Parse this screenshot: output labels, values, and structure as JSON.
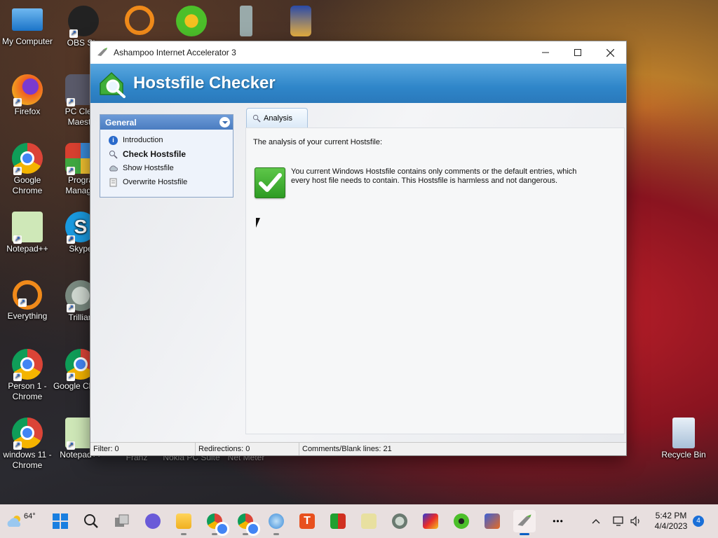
{
  "desktop": {
    "icons": [
      {
        "label": "My Computer"
      },
      {
        "label": "OBS Stu"
      },
      {
        "label": "Firefox"
      },
      {
        "label": "PC Clea Maestr"
      },
      {
        "label": "Google Chrome"
      },
      {
        "label": "Progra Manage"
      },
      {
        "label": "Notepad++"
      },
      {
        "label": "Skype"
      },
      {
        "label": "Everything"
      },
      {
        "label": "Trillian"
      },
      {
        "label": "Person 1 - Chrome"
      },
      {
        "label": "Google Chrom"
      },
      {
        "label": "windows 11 - Chrome"
      },
      {
        "label": "Notepad++"
      },
      {
        "label": "Franz"
      },
      {
        "label": "Nokia PC Suite"
      },
      {
        "label": "Net Meter"
      },
      {
        "label": "Recycle Bin"
      }
    ]
  },
  "window": {
    "title": "Ashampoo Internet Accelerator 3",
    "banner_title": "Hostsfile Checker",
    "sidebar": {
      "header": "General",
      "items": [
        {
          "label": "Introduction",
          "icon": "info-icon"
        },
        {
          "label": "Check Hostsfile",
          "icon": "magnifier-icon"
        },
        {
          "label": "Show Hostsfile",
          "icon": "cloud-icon"
        },
        {
          "label": "Overwrite Hostsfile",
          "icon": "document-icon"
        }
      ]
    },
    "tab": {
      "label": "Analysis"
    },
    "analysis": {
      "intro": "The analysis of your current Hostsfile:",
      "message": "You current Windows Hostsfile contains only comments or the default entries, which every host file needs to contain. This Hostsfile is harmless and not dangerous."
    },
    "status": {
      "filter": "Filter: 0",
      "redirections": "Redirections: 0",
      "comments": "Comments/Blank lines: 21"
    }
  },
  "taskbar": {
    "weather_temp": "64°",
    "time": "5:42 PM",
    "date": "4/4/2023",
    "notification_count": "4",
    "more": "•••"
  },
  "colors": {
    "banner": "#2f86c9",
    "sidebar_header": "#4a7cc0",
    "taskbar": "#e8dfdf"
  }
}
